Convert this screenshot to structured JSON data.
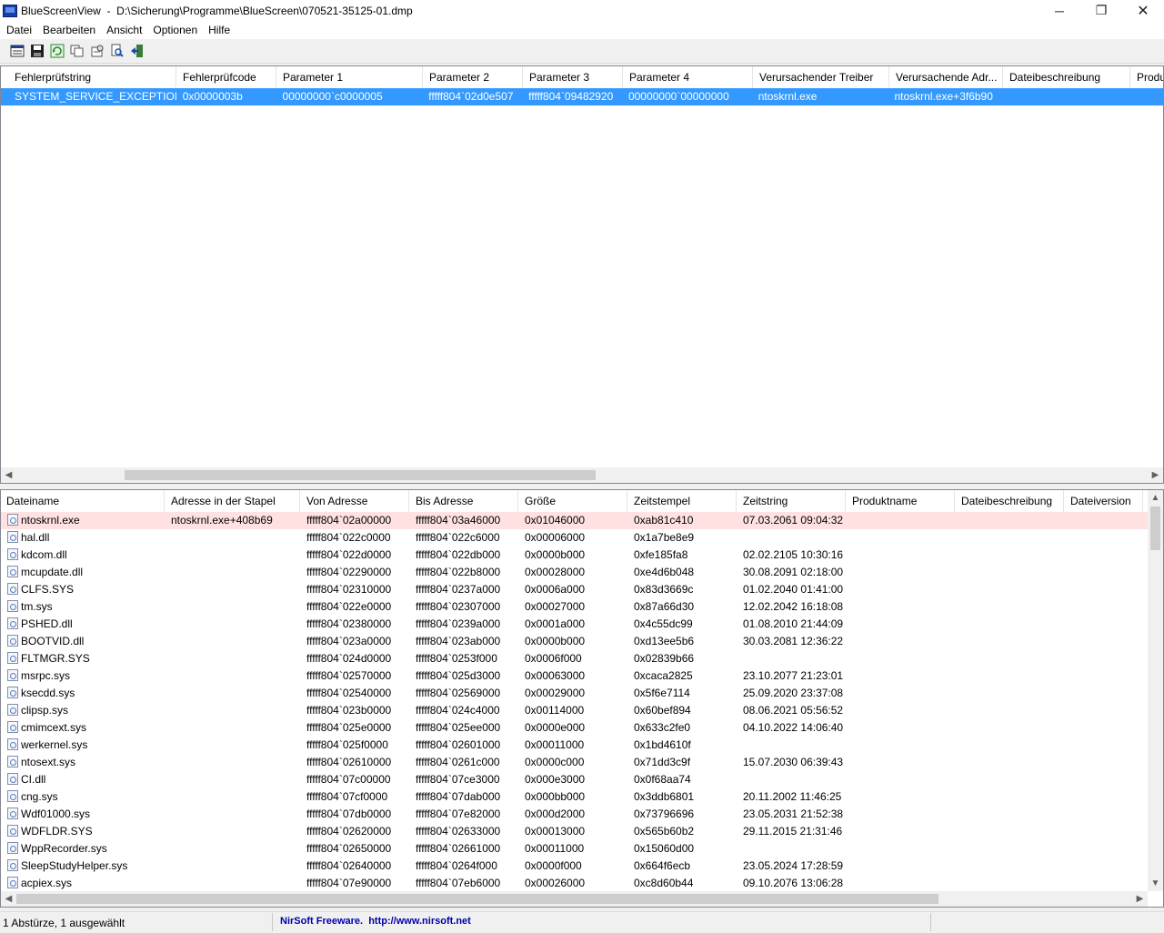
{
  "window": {
    "title": "BlueScreenView  -  D:\\Sicherung\\Programme\\BlueScreen\\070521-35125-01.dmp",
    "min_glyph": "─",
    "max_glyph": "❐",
    "close_glyph": "✕"
  },
  "menu": [
    "Datei",
    "Bearbeiten",
    "Ansicht",
    "Optionen",
    "Hilfe"
  ],
  "toolbar": [
    "html-report-icon",
    "save-icon",
    "refresh-icon",
    "copy-icon",
    "properties-icon",
    "find-icon",
    "exit-icon"
  ],
  "upper": {
    "columns": [
      "Fehlerprüfstring",
      "Fehlerprüfcode",
      "Parameter 1",
      "Parameter 2",
      "Parameter 3",
      "Parameter 4",
      "Verursachender Treiber",
      "Verursachende Adr...",
      "Dateibeschreibung",
      "Produ"
    ],
    "rows": [
      [
        "SYSTEM_SERVICE_EXCEPTION",
        "0x0000003b",
        "00000000`c0000005",
        "fffff804`02d0e507",
        "fffff804`09482920",
        "00000000`00000000",
        "ntoskrnl.exe",
        "ntoskrnl.exe+3f6b90",
        "",
        ""
      ]
    ]
  },
  "lower": {
    "columns": [
      "Dateiname",
      "Adresse in der Stapel",
      "Von Adresse",
      "Bis Adresse",
      "Größe",
      "Zeitstempel",
      "Zeitstring",
      "Produktname",
      "Dateibeschreibung",
      "Dateiversion"
    ],
    "sort_mark": "⁄",
    "rows": [
      [
        "ntoskrnl.exe",
        "ntoskrnl.exe+408b69",
        "fffff804`02a00000",
        "fffff804`03a46000",
        "0x01046000",
        "0xab81c410",
        "07.03.2061 09:04:32"
      ],
      [
        "hal.dll",
        "",
        "fffff804`022c0000",
        "fffff804`022c6000",
        "0x00006000",
        "0x1a7be8e9",
        ""
      ],
      [
        "kdcom.dll",
        "",
        "fffff804`022d0000",
        "fffff804`022db000",
        "0x0000b000",
        "0xfe185fa8",
        "02.02.2105 10:30:16"
      ],
      [
        "mcupdate.dll",
        "",
        "fffff804`02290000",
        "fffff804`022b8000",
        "0x00028000",
        "0xe4d6b048",
        "30.08.2091 02:18:00"
      ],
      [
        "CLFS.SYS",
        "",
        "fffff804`02310000",
        "fffff804`0237a000",
        "0x0006a000",
        "0x83d3669c",
        "01.02.2040 01:41:00"
      ],
      [
        "tm.sys",
        "",
        "fffff804`022e0000",
        "fffff804`02307000",
        "0x00027000",
        "0x87a66d30",
        "12.02.2042 16:18:08"
      ],
      [
        "PSHED.dll",
        "",
        "fffff804`02380000",
        "fffff804`0239a000",
        "0x0001a000",
        "0x4c55dc99",
        "01.08.2010 21:44:09"
      ],
      [
        "BOOTVID.dll",
        "",
        "fffff804`023a0000",
        "fffff804`023ab000",
        "0x0000b000",
        "0xd13ee5b6",
        "30.03.2081 12:36:22"
      ],
      [
        "FLTMGR.SYS",
        "",
        "fffff804`024d0000",
        "fffff804`0253f000",
        "0x0006f000",
        "0x02839b66",
        ""
      ],
      [
        "msrpc.sys",
        "",
        "fffff804`02570000",
        "fffff804`025d3000",
        "0x00063000",
        "0xcaca2825",
        "23.10.2077 21:23:01"
      ],
      [
        "ksecdd.sys",
        "",
        "fffff804`02540000",
        "fffff804`02569000",
        "0x00029000",
        "0x5f6e7114",
        "25.09.2020 23:37:08"
      ],
      [
        "clipsp.sys",
        "",
        "fffff804`023b0000",
        "fffff804`024c4000",
        "0x00114000",
        "0x60bef894",
        "08.06.2021 05:56:52"
      ],
      [
        "cmimcext.sys",
        "",
        "fffff804`025e0000",
        "fffff804`025ee000",
        "0x0000e000",
        "0x633c2fe0",
        "04.10.2022 14:06:40"
      ],
      [
        "werkernel.sys",
        "",
        "fffff804`025f0000",
        "fffff804`02601000",
        "0x00011000",
        "0x1bd4610f",
        ""
      ],
      [
        "ntosext.sys",
        "",
        "fffff804`02610000",
        "fffff804`0261c000",
        "0x0000c000",
        "0x71dd3c9f",
        "15.07.2030 06:39:43"
      ],
      [
        "CI.dll",
        "",
        "fffff804`07c00000",
        "fffff804`07ce3000",
        "0x000e3000",
        "0x0f68aa74",
        ""
      ],
      [
        "cng.sys",
        "",
        "fffff804`07cf0000",
        "fffff804`07dab000",
        "0x000bb000",
        "0x3ddb6801",
        "20.11.2002 11:46:25"
      ],
      [
        "Wdf01000.sys",
        "",
        "fffff804`07db0000",
        "fffff804`07e82000",
        "0x000d2000",
        "0x73796696",
        "23.05.2031 21:52:38"
      ],
      [
        "WDFLDR.SYS",
        "",
        "fffff804`02620000",
        "fffff804`02633000",
        "0x00013000",
        "0x565b60b2",
        "29.11.2015 21:31:46"
      ],
      [
        "WppRecorder.sys",
        "",
        "fffff804`02650000",
        "fffff804`02661000",
        "0x00011000",
        "0x15060d00",
        ""
      ],
      [
        "SleepStudyHelper.sys",
        "",
        "fffff804`02640000",
        "fffff804`0264f000",
        "0x0000f000",
        "0x664f6ecb",
        "23.05.2024 17:28:59"
      ],
      [
        "acpiex.sys",
        "",
        "fffff804`07e90000",
        "fffff804`07eb6000",
        "0x00026000",
        "0xc8d60b44",
        "09.10.2076 13:06:28"
      ]
    ]
  },
  "status": {
    "count": "1 Abstürze, 1 ausgewählt",
    "credit": "NirSoft Freeware.  http://www.nirsoft.net"
  },
  "colors": {
    "selection": "#3399ff",
    "highlight_row": "#ffe1e1",
    "credit_text": "#0000aa"
  }
}
